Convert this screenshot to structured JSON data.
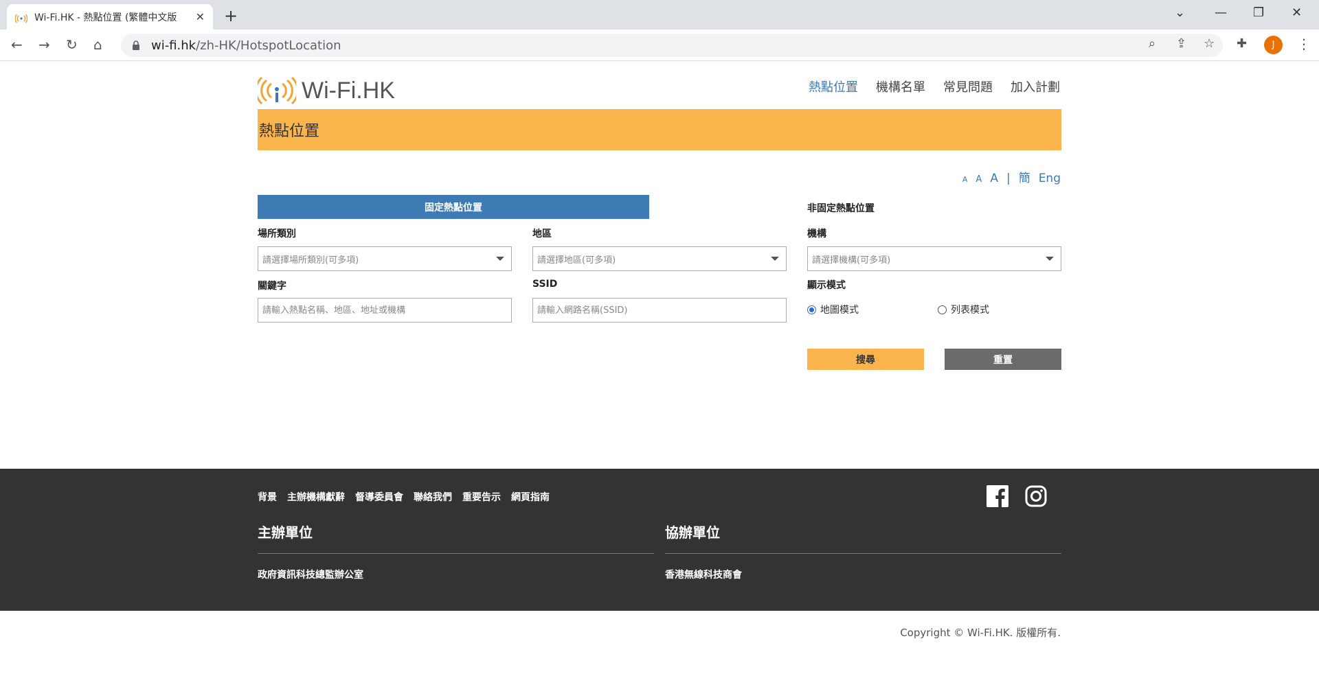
{
  "browser": {
    "tab_title": "Wi-Fi.HK - 熱點位置 (繁體中文版",
    "url_host": "wi-fi.hk",
    "url_path": "/zh-HK/HotspotLocation",
    "avatar_letter": "J"
  },
  "header": {
    "logo_text": "Wi-Fi.HK",
    "nav": [
      "熱點位置",
      "機構名單",
      "常見問題",
      "加入計劃"
    ]
  },
  "banner_title": "熱點位置",
  "font_controls": {
    "small": "A",
    "medium": "A",
    "large": "A",
    "separator": "|",
    "simplified": "簡",
    "english": "Eng"
  },
  "form": {
    "fixed_tab": "固定熱點位置",
    "nonfixed_label": "非固定熱點位置",
    "venue_label": "場所類別",
    "venue_placeholder": "請選擇場所類別(可多項)",
    "district_label": "地區",
    "district_placeholder": "請選擇地區(可多項)",
    "org_label": "機構",
    "org_placeholder": "請選擇機構(可多項)",
    "keyword_label": "關鍵字",
    "keyword_placeholder": "請輸入熱點名稱、地區、地址或機構",
    "ssid_label": "SSID",
    "ssid_placeholder": "請輸入網路名稱(SSID)",
    "mode_label": "顯示模式",
    "mode_map": "地圖模式",
    "mode_list": "列表模式",
    "search_button": "搜尋",
    "reset_button": "重置"
  },
  "footer": {
    "links": [
      "背景",
      "主辦機構獻辭",
      "督導委員會",
      "聯絡我們",
      "重要告示",
      "網頁指南"
    ],
    "organiser_heading": "主辦單位",
    "organiser_name": "政府資訊科技總監辦公室",
    "coorganiser_heading": "協辦單位",
    "coorganiser_name": "香港無線科技商會",
    "copyright": "Copyright © Wi-Fi.HK. 版權所有."
  },
  "colors": {
    "accent_orange": "#f9b54b",
    "accent_blue": "#3e7ab4",
    "footer_bg": "#333333"
  }
}
